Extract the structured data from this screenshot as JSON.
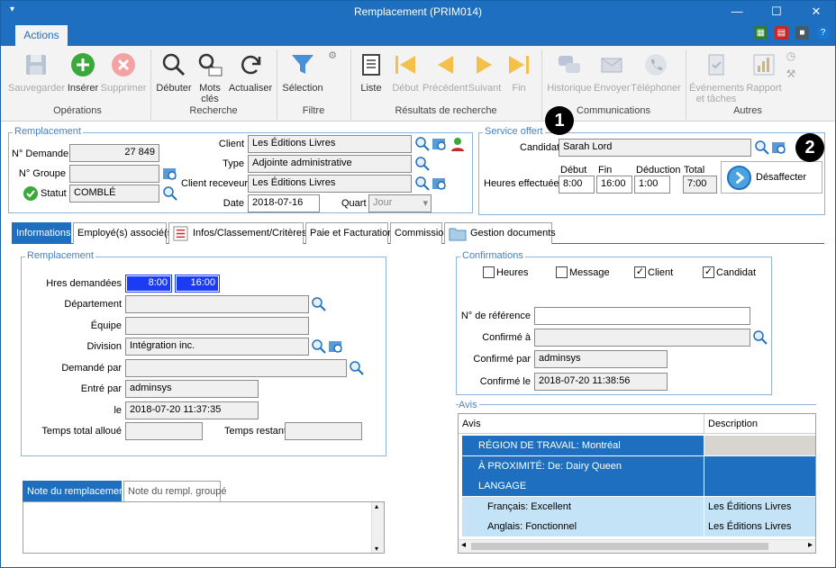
{
  "window": {
    "title": "Remplacement (PRIM014)",
    "minimize": "—",
    "maximize": "☐",
    "close": "✕"
  },
  "ribbon": {
    "tab": "Actions",
    "buttons": {
      "save": "Sauvegarder",
      "insert": "Insérer",
      "delete": "Supprimer",
      "start": "Débuter",
      "keywords_l1": "Mots",
      "keywords_l2": "clés",
      "refresh": "Actualiser",
      "selection": "Sélection",
      "list": "Liste",
      "first": "Début",
      "prev": "Précédent",
      "next": "Suivant",
      "last": "Fin",
      "history": "Historique",
      "send": "Envoyer",
      "phone": "Téléphoner",
      "events_l1": "Événements",
      "events_l2": "et tâches",
      "report": "Rapport"
    },
    "groups": {
      "ops": "Opérations",
      "search": "Recherche",
      "filter": "Filtre",
      "results": "Résultats de recherche",
      "comms": "Communications",
      "others": "Autres"
    }
  },
  "remplacement": {
    "legend": "Remplacement",
    "no_demande_label": "N° Demande",
    "no_demande": "27 849",
    "no_groupe_label": "N° Groupe",
    "no_groupe": "",
    "statut_label": "Statut",
    "statut": "COMBLÉ",
    "client_label": "Client",
    "client": "Les Éditions Livres",
    "type_label": "Type",
    "type": "Adjointe administrative",
    "client_receveur_label": "Client receveur",
    "client_receveur": "Les Éditions Livres",
    "date_label": "Date",
    "date": "2018-07-16",
    "quart_label": "Quart",
    "quart": "Jour"
  },
  "service": {
    "legend": "Service offert",
    "candidat_label": "Candidat",
    "candidat": "Sarah Lord",
    "heures_label": "Heures effectuées",
    "debut_label": "Début",
    "debut": "8:00",
    "fin_label": "Fin",
    "fin": "16:00",
    "deduction_label": "Déduction",
    "deduction": "1:00",
    "total_label": "Total",
    "total": "7:00",
    "desaffecter": "Désaffecter"
  },
  "callouts": [
    "1",
    "2"
  ],
  "tabs": [
    "Informations",
    "Employé(s) associé(s)",
    "Infos/Classement/Critères",
    "Paie et Facturation",
    "Commission",
    "Gestion documents"
  ],
  "detail": {
    "legend": "Remplacement",
    "hres_label": "Hres demandées",
    "hres_debut": "8:00",
    "hres_fin": "16:00",
    "departement_label": "Département",
    "departement": "",
    "equipe_label": "Équipe",
    "equipe": "",
    "division_label": "Division",
    "division": "Intégration inc.",
    "demande_par_label": "Demandé par",
    "demande_par": "",
    "entre_par_label": "Entré par",
    "entre_par": "adminsys",
    "le_label": "le",
    "le": "2018-07-20 11:37:35",
    "temps_total_label": "Temps total alloué",
    "temps_total": "",
    "temps_restant_label": "Temps restant",
    "temps_restant": ""
  },
  "confirmations": {
    "legend": "Confirmations",
    "heures": "Heures",
    "message": "Message",
    "client": "Client",
    "candidat": "Candidat",
    "heures_checked": false,
    "message_checked": false,
    "client_checked": true,
    "candidat_checked": true,
    "reference_label": "N° de référence",
    "reference": "",
    "confirme_a_label": "Confirmé à",
    "confirme_a": "",
    "confirme_par_label": "Confirmé par",
    "confirme_par": "adminsys",
    "confirme_le_label": "Confirmé le",
    "confirme_le": "2018-07-20 11:38:56"
  },
  "avis": {
    "legend": "Avis",
    "col_avis": "Avis",
    "col_desc": "Description",
    "rows": [
      {
        "avis": "RÉGION DE TRAVAIL: Montréal",
        "desc": ""
      },
      {
        "avis": "À PROXIMITÉ: De: Dairy Queen",
        "desc": ""
      },
      {
        "avis": "LANGAGE",
        "desc": ""
      },
      {
        "avis": "Français: Excellent",
        "desc": "Les Éditions Livres"
      },
      {
        "avis": "Anglais: Fonctionnel",
        "desc": "Les Éditions Livres"
      }
    ]
  },
  "notes": {
    "tab1": "Note du remplacement",
    "tab2": "Note du rempl. groupé"
  },
  "colors": {
    "accent": "#1e6fbf",
    "highlight": "#1c3cf4",
    "light_row": "#c5e3f6",
    "ok_green": "#3aa83a"
  }
}
